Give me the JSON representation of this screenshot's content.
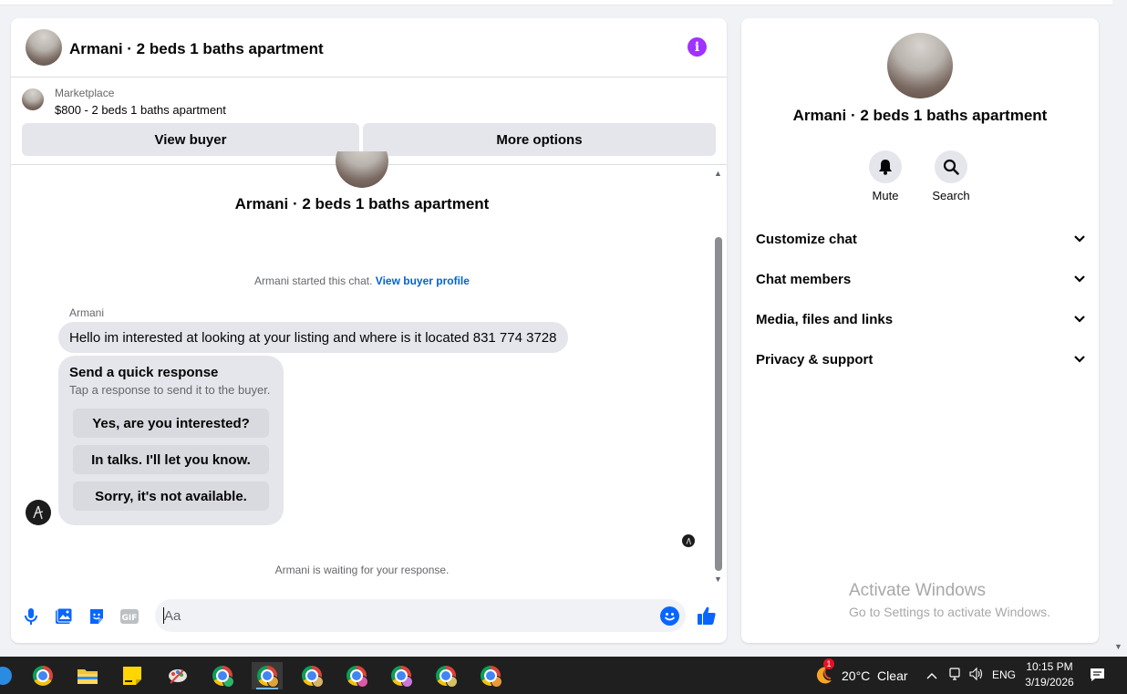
{
  "chat": {
    "title": "Armani · 2 beds 1 baths apartment",
    "marketplace_label": "Marketplace",
    "listing": "$800 - 2 beds 1 baths apartment",
    "view_buyer": "View buyer",
    "more_options": "More options",
    "thread_title": "Armani · 2 beds 1 baths apartment",
    "started_text": "Armani started this chat.",
    "started_link": "View buyer profile",
    "sender": "Armani",
    "message": "Hello im interested at looking at your listing and where is it located 831 774 3728",
    "quick_title": "Send a quick response",
    "quick_sub": "Tap a response to send it to the buyer.",
    "quick_responses": [
      "Yes, are you interested?",
      "In talks. I'll let you know.",
      "Sorry, it's not available."
    ],
    "waiting": "Armani is waiting for your response.",
    "composer_placeholder": "Aa"
  },
  "info": {
    "title": "Armani · 2 beds 1 baths apartment",
    "mute": "Mute",
    "search": "Search",
    "rows": [
      "Customize chat",
      "Chat members",
      "Media, files and links",
      "Privacy & support"
    ]
  },
  "watermark": {
    "line1": "Activate Windows",
    "line2": "Go to Settings to activate Windows."
  },
  "taskbar": {
    "weather_badge": "1",
    "weather": "20°C  Clear",
    "lang": "ENG",
    "time": "10:15 PM",
    "date": "3/19/2026"
  },
  "colors": {
    "accent": "#0866ff",
    "info_purple": "#a033ff",
    "link": "#0064d1",
    "button_bg": "#e4e6eb"
  },
  "icons": {
    "header": "info-icon",
    "composer": [
      "microphone-icon",
      "gallery-icon",
      "sticker-icon",
      "gif-icon",
      "emoji-icon",
      "thumbs-up-icon"
    ],
    "actions": [
      "bell-icon",
      "search-icon"
    ],
    "rows": "chevron-down-icon"
  }
}
